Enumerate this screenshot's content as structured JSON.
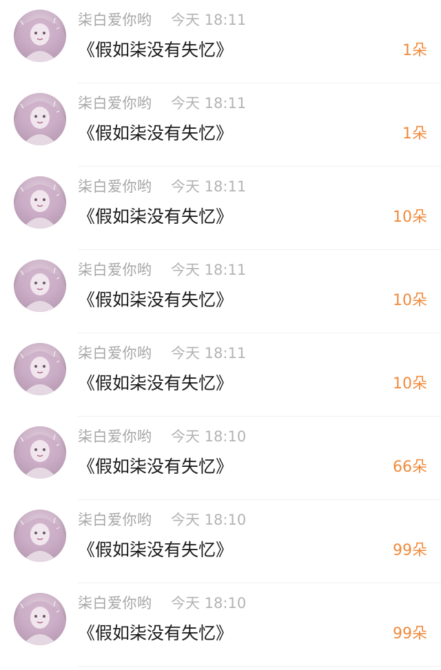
{
  "messages": [
    {
      "username": "柒白爱你哟",
      "time": "今天 18:11",
      "title": "《假如柒没有失忆》",
      "count": "1朵"
    },
    {
      "username": "柒白爱你哟",
      "time": "今天 18:11",
      "title": "《假如柒没有失忆》",
      "count": "1朵"
    },
    {
      "username": "柒白爱你哟",
      "time": "今天 18:11",
      "title": "《假如柒没有失忆》",
      "count": "10朵"
    },
    {
      "username": "柒白爱你哟",
      "time": "今天 18:11",
      "title": "《假如柒没有失忆》",
      "count": "10朵"
    },
    {
      "username": "柒白爱你哟",
      "time": "今天 18:11",
      "title": "《假如柒没有失忆》",
      "count": "10朵"
    },
    {
      "username": "柒白爱你哟",
      "time": "今天 18:10",
      "title": "《假如柒没有失忆》",
      "count": "66朵"
    },
    {
      "username": "柒白爱你哟",
      "time": "今天 18:10",
      "title": "《假如柒没有失忆》",
      "count": "99朵"
    },
    {
      "username": "柒白爱你哟",
      "time": "今天 18:10",
      "title": "《假如柒没有失忆》",
      "count": "99朵"
    }
  ],
  "colors": {
    "username": "#a6a6a6",
    "time": "#b3b3b3",
    "title": "#1a1a1a",
    "count": "#f08a3c"
  },
  "icons": {
    "avatar": "avatar-illustration"
  }
}
